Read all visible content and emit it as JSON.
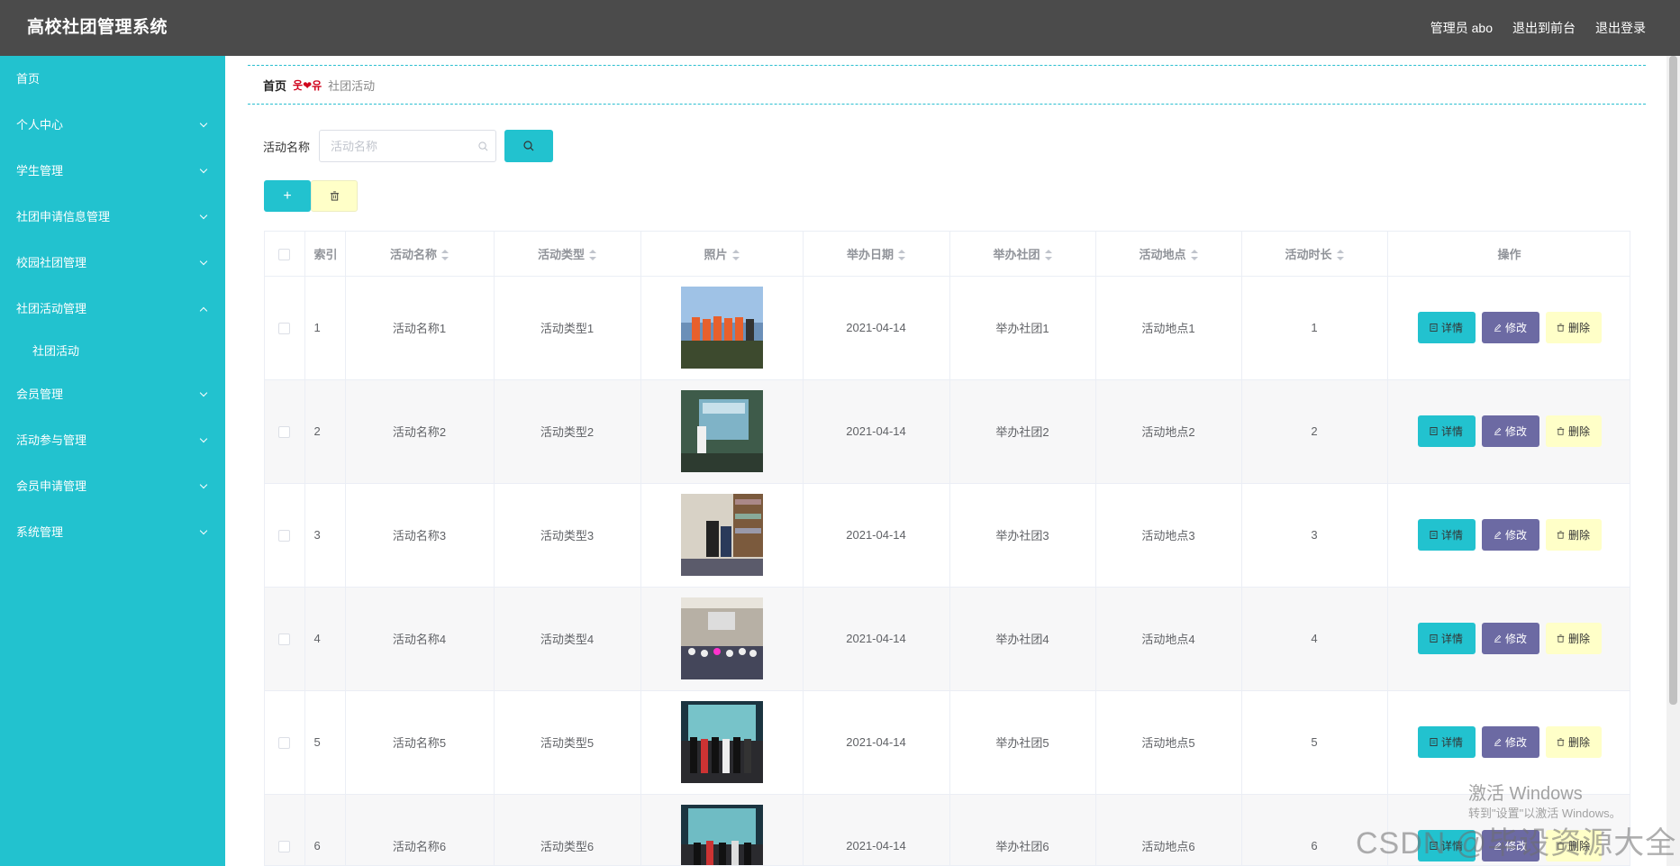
{
  "header": {
    "title": "高校社团管理系统",
    "admin": "管理员 abo",
    "to_front": "退出到前台",
    "logout": "退出登录"
  },
  "sidebar": {
    "items": [
      {
        "label": "首页",
        "arrow": "none"
      },
      {
        "label": "个人中心",
        "arrow": "down"
      },
      {
        "label": "学生管理",
        "arrow": "down"
      },
      {
        "label": "社团申请信息管理",
        "arrow": "down"
      },
      {
        "label": "校园社团管理",
        "arrow": "down"
      },
      {
        "label": "社团活动管理",
        "arrow": "up"
      },
      {
        "label": "社团活动",
        "sub": true
      },
      {
        "label": "会员管理",
        "arrow": "down"
      },
      {
        "label": "活动参与管理",
        "arrow": "down"
      },
      {
        "label": "会员申请管理",
        "arrow": "down"
      },
      {
        "label": "系统管理",
        "arrow": "down"
      }
    ]
  },
  "breadcrumb": {
    "home": "首页",
    "current": "社团活动"
  },
  "search": {
    "label": "活动名称",
    "placeholder": "活动名称"
  },
  "table": {
    "columns": [
      "索引",
      "活动名称",
      "活动类型",
      "照片",
      "举办日期",
      "举办社团",
      "活动地点",
      "活动时长",
      "操作"
    ],
    "rows": [
      {
        "index": "1",
        "name": "活动名称1",
        "type": "活动类型1",
        "date": "2021-04-14",
        "club": "举办社团1",
        "place": "活动地点1",
        "duration": "1"
      },
      {
        "index": "2",
        "name": "活动名称2",
        "type": "活动类型2",
        "date": "2021-04-14",
        "club": "举办社团2",
        "place": "活动地点2",
        "duration": "2"
      },
      {
        "index": "3",
        "name": "活动名称3",
        "type": "活动类型3",
        "date": "2021-04-14",
        "club": "举办社团3",
        "place": "活动地点3",
        "duration": "3"
      },
      {
        "index": "4",
        "name": "活动名称4",
        "type": "活动类型4",
        "date": "2021-04-14",
        "club": "举办社团4",
        "place": "活动地点4",
        "duration": "4"
      },
      {
        "index": "5",
        "name": "活动名称5",
        "type": "活动类型5",
        "date": "2021-04-14",
        "club": "举办社团5",
        "place": "活动地点5",
        "duration": "5"
      },
      {
        "index": "6",
        "name": "活动名称6",
        "type": "活动类型6",
        "date": "2021-04-14",
        "club": "举办社团6",
        "place": "活动地点6",
        "duration": "6"
      }
    ],
    "ops": {
      "detail": "详情",
      "edit": "修改",
      "delete": "删除"
    }
  },
  "watermark": {
    "line1": "激活 Windows",
    "line2": "转到\"设置\"以激活 Windows。",
    "csdn": "CSDN @毕设资源大全"
  },
  "colors": {
    "accent": "#22c2cf",
    "header_bg": "#4b4b4b",
    "edit_btn": "#6c6aa3",
    "delete_btn": "#ffffc8"
  }
}
